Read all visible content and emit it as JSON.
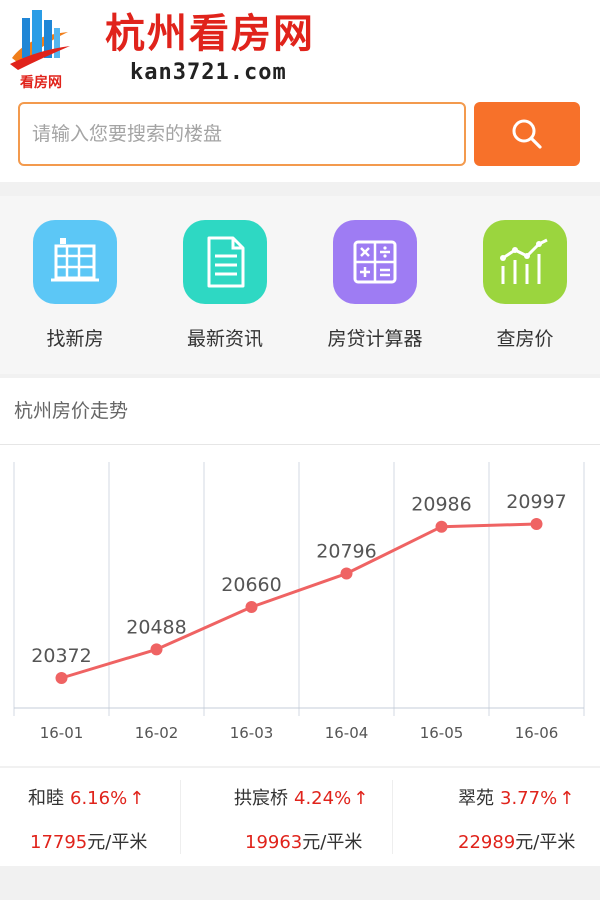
{
  "header": {
    "logo_small": "看房网",
    "brand_title": "杭州看房网",
    "brand_domain": "kan3721.com"
  },
  "search": {
    "placeholder": "请输入您要搜索的楼盘",
    "button_icon": "search-icon"
  },
  "nav": {
    "items": [
      {
        "label": "找新房",
        "icon": "building-icon",
        "color": "#5cc7f6"
      },
      {
        "label": "最新资讯",
        "icon": "document-icon",
        "color": "#2ed8c3"
      },
      {
        "label": "房贷计算器",
        "icon": "calculator-icon",
        "color": "#9e7cf3"
      },
      {
        "label": "查房价",
        "icon": "price-chart-icon",
        "color": "#9bd53e"
      }
    ]
  },
  "trend": {
    "title": "杭州房价走势"
  },
  "chart_data": {
    "type": "line",
    "categories": [
      "16-01",
      "16-02",
      "16-03",
      "16-04",
      "16-05",
      "16-06"
    ],
    "values": [
      20372,
      20488,
      20660,
      20796,
      20986,
      20997
    ],
    "data_labels": [
      "20372",
      "20488",
      "20660",
      "20796",
      "20986",
      "20997"
    ],
    "color": "#ef6363",
    "grid": true
  },
  "stats": {
    "items": [
      {
        "name": "和睦",
        "pct": "6.16%",
        "arrow": "↑",
        "price": "17795",
        "unit": "元/平米"
      },
      {
        "name": "拱宸桥",
        "pct": "4.24%",
        "arrow": "↑",
        "price": "19963",
        "unit": "元/平米"
      },
      {
        "name": "翠苑",
        "pct": "3.77%",
        "arrow": "↑",
        "price": "22989",
        "unit": "元/平米"
      }
    ]
  },
  "colors": {
    "brand_red": "#e0231b",
    "accent_orange": "#f7712a"
  }
}
